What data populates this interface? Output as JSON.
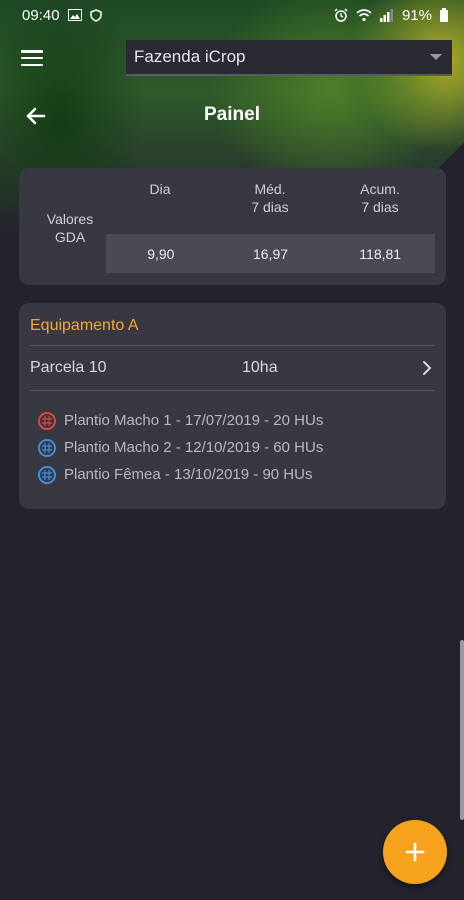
{
  "status_bar": {
    "time": "09:40",
    "battery": "91%",
    "icons": [
      "image-icon",
      "shield-icon",
      "alarm-icon",
      "wifi-icon",
      "signal-icon",
      "battery-icon"
    ]
  },
  "header": {
    "farm_select_value": "Fazenda iCrop",
    "title": "Painel"
  },
  "gda_card": {
    "row_label_1": "Valores",
    "row_label_2": "GDA",
    "columns": [
      {
        "line1": "Dia",
        "line2": "",
        "value": "9,90"
      },
      {
        "line1": "Méd.",
        "line2": "7 dias",
        "value": "16,97"
      },
      {
        "line1": "Acum.",
        "line2": "7 dias",
        "value": "118,81"
      }
    ]
  },
  "equipment_card": {
    "title": "Equipamento A",
    "parcela": "Parcela 10",
    "area": "10ha",
    "plantios": [
      {
        "text": "Plantio Macho 1 - 17/07/2019 - 20 HUs",
        "color": "#e0443a"
      },
      {
        "text": "Plantio Macho 2 - 12/10/2019 - 60 HUs",
        "color": "#3a8fe0"
      },
      {
        "text": "Plantio Fêmea - 13/10/2019 - 90 HUs",
        "color": "#3a8fe0"
      }
    ]
  },
  "colors": {
    "accent": "#f7a21d",
    "equipment_title": "#f3a63a",
    "background": "#23232d",
    "card": "#383842"
  }
}
